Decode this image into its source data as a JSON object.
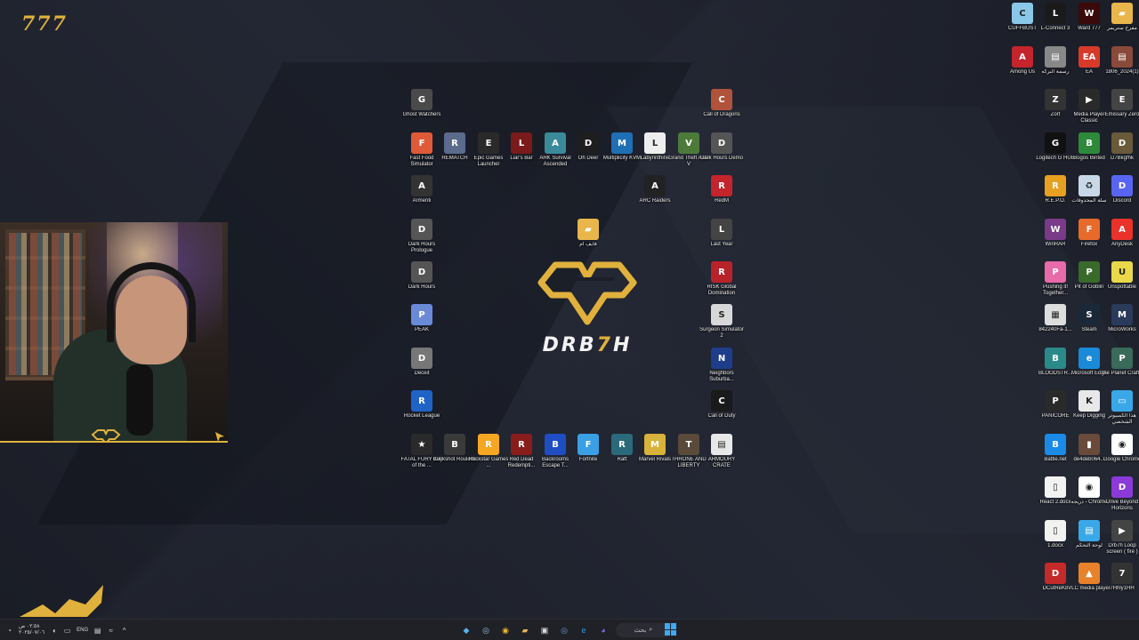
{
  "desktop": {
    "corner_logo": "777",
    "center_logo": {
      "brand_left": "DRB",
      "brand_seven": "7",
      "brand_right": "H"
    },
    "accent_color": "#e0b13c",
    "icons": [
      {
        "id": "ghost-watchers",
        "label": "Ghost Watchers",
        "glyph": "G",
        "color": "#4a4a4a"
      },
      {
        "id": "call-of-dragons",
        "label": "Call of Dragons",
        "glyph": "C",
        "color": "#b0533a"
      },
      {
        "id": "fast-food-simulator",
        "label": "Fast Food Simulator",
        "glyph": "F",
        "color": "#e05a3a"
      },
      {
        "id": "rematch",
        "label": "REMATCH",
        "glyph": "R",
        "color": "#5a6b8c"
      },
      {
        "id": "epic-games-launcher",
        "label": "Epic Games Launcher",
        "glyph": "E",
        "color": "#2a2a2a"
      },
      {
        "id": "liars-bar",
        "label": "Liar's Bar",
        "glyph": "L",
        "color": "#7a1a1a"
      },
      {
        "id": "ark-survival-ascended",
        "label": "ARK Survival Ascended",
        "glyph": "A",
        "color": "#3a8a9a"
      },
      {
        "id": "oh-deer",
        "label": "Oh Deer",
        "glyph": "D",
        "color": "#1e1e1e"
      },
      {
        "id": "multiplicity-kvm",
        "label": "Multiplicity KVM",
        "glyph": "M",
        "color": "#1f6fb5"
      },
      {
        "id": "labyrinthine",
        "label": "Labyrinthine",
        "glyph": "L",
        "color": "#eeeeee"
      },
      {
        "id": "grand-theft-auto-v",
        "label": "Grand Theft Auto V",
        "glyph": "V",
        "color": "#4d7a3a"
      },
      {
        "id": "dark-hours-demo",
        "label": "Dark Hours Demo",
        "glyph": "D",
        "color": "#555"
      },
      {
        "id": "armenti",
        "label": "Armenti",
        "glyph": "A",
        "color": "#333"
      },
      {
        "id": "arc-raiders",
        "label": "ARC Raiders",
        "glyph": "A",
        "color": "#222"
      },
      {
        "id": "redm",
        "label": "RedM",
        "glyph": "R",
        "color": "#c4242b"
      },
      {
        "id": "dark-hours-prologue",
        "label": "Dark Hours Prologue",
        "glyph": "D",
        "color": "#555"
      },
      {
        "id": "folder-arabic",
        "label": "فايف ام",
        "glyph": "▰",
        "color": "#e8b64a"
      },
      {
        "id": "last-year",
        "label": "Last Year",
        "glyph": "L",
        "color": "#444"
      },
      {
        "id": "dark-hours",
        "label": "Dark Hours",
        "glyph": "D",
        "color": "#555"
      },
      {
        "id": "risk-global-domination",
        "label": "RISK Global Domination",
        "glyph": "R",
        "color": "#b8232a"
      },
      {
        "id": "peak",
        "label": "PEAK",
        "glyph": "P",
        "color": "#6a8ad8"
      },
      {
        "id": "surgeon-simulator-2",
        "label": "Surgeon Simulator 2",
        "glyph": "S",
        "color": "#d8d8d8"
      },
      {
        "id": "deceit",
        "label": "Deceit",
        "glyph": "D",
        "color": "#777"
      },
      {
        "id": "neighbors-suburban",
        "label": "Neighbors Suburba...",
        "glyph": "N",
        "color": "#1e3d8a"
      },
      {
        "id": "rocket-league",
        "label": "Rocket League",
        "glyph": "R",
        "color": "#1f63c6"
      },
      {
        "id": "call-of-duty",
        "label": "Call of Duty",
        "glyph": "C",
        "color": "#1a1a1a"
      },
      {
        "id": "fatal-fury",
        "label": "FATAL FURY City of the ...",
        "glyph": "★",
        "color": "#2a2a2a"
      },
      {
        "id": "buckshot-roulette",
        "label": "Buckshot Roulette",
        "glyph": "B",
        "color": "#3a3a3a"
      },
      {
        "id": "rockstar-games",
        "label": "Rockstar Games ...",
        "glyph": "R",
        "color": "#f5a623"
      },
      {
        "id": "red-dead-redemption",
        "label": "Red Dead Redempti...",
        "glyph": "R",
        "color": "#8a1c1c"
      },
      {
        "id": "backrooms-escape",
        "label": "Backrooms Escape T...",
        "glyph": "B",
        "color": "#1e4ec2"
      },
      {
        "id": "fortnite",
        "label": "Fortnite",
        "glyph": "F",
        "color": "#3aa0e6"
      },
      {
        "id": "raft",
        "label": "Raft",
        "glyph": "R",
        "color": "#2a6a7a"
      },
      {
        "id": "marvel-rivals",
        "label": "Marvel Rivals",
        "glyph": "M",
        "color": "#d8b23a"
      },
      {
        "id": "throne-and-liberty",
        "label": "THRONE AND LIBERTY",
        "glyph": "T",
        "color": "#5a4a3a"
      },
      {
        "id": "armoury-crate",
        "label": "ARMOURY CRATE",
        "glyph": "▤",
        "color": "#e8e8e8"
      },
      {
        "id": "cuffbust",
        "label": "CUFFBUST",
        "glyph": "C",
        "color": "#8ac8e8"
      },
      {
        "id": "l-connect-3",
        "label": "L-Connect 3",
        "glyph": "L",
        "color": "#1a1a1a"
      },
      {
        "id": "ward-777",
        "label": "Ward 777",
        "glyph": "W",
        "color": "#3a0a0a"
      },
      {
        "id": "folder-streamer",
        "label": "مفرخ ستريمر",
        "glyph": "▰",
        "color": "#e8b64a"
      },
      {
        "id": "among-us",
        "label": "Among Us",
        "glyph": "A",
        "color": "#c4242b"
      },
      {
        "id": "arabic-drawing",
        "label": "رسمة البركه",
        "glyph": "▤",
        "color": "#888"
      },
      {
        "id": "ea",
        "label": "EA",
        "glyph": "EA",
        "color": "#d83a2a"
      },
      {
        "id": "file-2024",
        "label": "1806_2024(1)",
        "glyph": "▤",
        "color": "#8a4a3a"
      },
      {
        "id": "zort",
        "label": "Zort",
        "glyph": "Z",
        "color": "#333"
      },
      {
        "id": "media-player-classic",
        "label": "Media Player Classic",
        "glyph": "▶",
        "color": "#2a2a2a"
      },
      {
        "id": "emissary-zero",
        "label": "Emissary Zero",
        "glyph": "E",
        "color": "#444"
      },
      {
        "id": "logitech-g-hub",
        "label": "Logitech G HUB",
        "glyph": "G",
        "color": "#111"
      },
      {
        "id": "bogos-binted",
        "label": "Bogos Binted",
        "glyph": "B",
        "color": "#2e8a3a"
      },
      {
        "id": "d7bkgfhk",
        "label": "D7Bkgfhk",
        "glyph": "D",
        "color": "#6a5a3a"
      },
      {
        "id": "repo",
        "label": "R.E.P.O.",
        "glyph": "R",
        "color": "#e8a020"
      },
      {
        "id": "recycle-bin",
        "label": "سلة المحذوفات",
        "glyph": "♻",
        "color": "#c8d8e8"
      },
      {
        "id": "discord",
        "label": "Discord",
        "glyph": "D",
        "color": "#5865f2"
      },
      {
        "id": "winrar",
        "label": "WinRAR",
        "glyph": "W",
        "color": "#7a3a8a"
      },
      {
        "id": "firefox",
        "label": "Firefox",
        "glyph": "F",
        "color": "#e86a2a"
      },
      {
        "id": "anydesk",
        "label": "AnyDesk",
        "glyph": "A",
        "color": "#e8322a"
      },
      {
        "id": "pushing-it-together",
        "label": "Pushing it! Together...",
        "glyph": "P",
        "color": "#e86aa8"
      },
      {
        "id": "pit-of-goblin",
        "label": "Pit of Goblin",
        "glyph": "P",
        "color": "#3a6a2a"
      },
      {
        "id": "unspottable",
        "label": "Unspottable",
        "glyph": "U",
        "color": "#e8d84a"
      },
      {
        "id": "qr-image",
        "label": "842240Fa-1...",
        "glyph": "▦",
        "color": "#dddddd"
      },
      {
        "id": "steam",
        "label": "Steam",
        "glyph": "S",
        "color": "#1b2838"
      },
      {
        "id": "microworks",
        "label": "MicroWorks",
        "glyph": "M",
        "color": "#2a3a5a"
      },
      {
        "id": "bloodstrike",
        "label": "BLOODSTR...",
        "glyph": "B",
        "color": "#2a8a8a"
      },
      {
        "id": "microsoft-edge",
        "label": "Microsoft Edge",
        "glyph": "e",
        "color": "#1a8ad8"
      },
      {
        "id": "the-planet-crafter",
        "label": "The Planet Crafter",
        "glyph": "P",
        "color": "#3a6a5a"
      },
      {
        "id": "panicore",
        "label": "PANICORE",
        "glyph": "P",
        "color": "#2a2a2a"
      },
      {
        "id": "keep-digging",
        "label": "Keep Digging",
        "glyph": "K",
        "color": "#e8e8e8"
      },
      {
        "id": "this-pc",
        "label": "هذا الكمبيوتر الشخصي",
        "glyph": "▭",
        "color": "#3aa8e8"
      },
      {
        "id": "battle-net",
        "label": "Battle.net",
        "glyph": "B",
        "color": "#1a8ae8"
      },
      {
        "id": "de4deb",
        "label": "de4deb064...",
        "glyph": "▮",
        "color": "#6a4a3a"
      },
      {
        "id": "google-chrome",
        "label": "Google Chrome",
        "glyph": "◉",
        "color": "#ffffff"
      },
      {
        "id": "react-2-docx",
        "label": "React 2.docx",
        "glyph": "▯",
        "color": "#f2f2f2"
      },
      {
        "id": "chrome-arabic",
        "label": "دريجه - Chrome",
        "glyph": "◉",
        "color": "#ffffff"
      },
      {
        "id": "drive-beyond-horizons",
        "label": "Drive Beyond Horizons",
        "glyph": "D",
        "color": "#8a3ad8"
      },
      {
        "id": "one-docx",
        "label": "1.docx",
        "glyph": "▯",
        "color": "#f2f2f2"
      },
      {
        "id": "control-panel",
        "label": "لوحة التحكم",
        "glyph": "▤",
        "color": "#3aa8e8"
      },
      {
        "id": "drb7h-loop-screen",
        "label": "Drb7h Loop screen ( fire )",
        "glyph": "▶",
        "color": "#444"
      },
      {
        "id": "dcutrek8",
        "label": "DCutReK8",
        "glyph": "D",
        "color": "#c42a2a"
      },
      {
        "id": "vlc-media-player",
        "label": "VLC media player",
        "glyph": "▲",
        "color": "#e8822a"
      },
      {
        "id": "7hhly1hh",
        "label": "7Hhly1HH",
        "glyph": "7",
        "color": "#333"
      }
    ]
  },
  "webcam": {
    "overlay_logo": "DRB7H"
  },
  "taskbar": {
    "clock_time": "٠٢:٥٨ ص",
    "clock_date": "٢٠٢٥/٠٧/٠٦",
    "language": "ENG",
    "search_label": "بحث",
    "search_icon_glyph": "⌕"
  }
}
